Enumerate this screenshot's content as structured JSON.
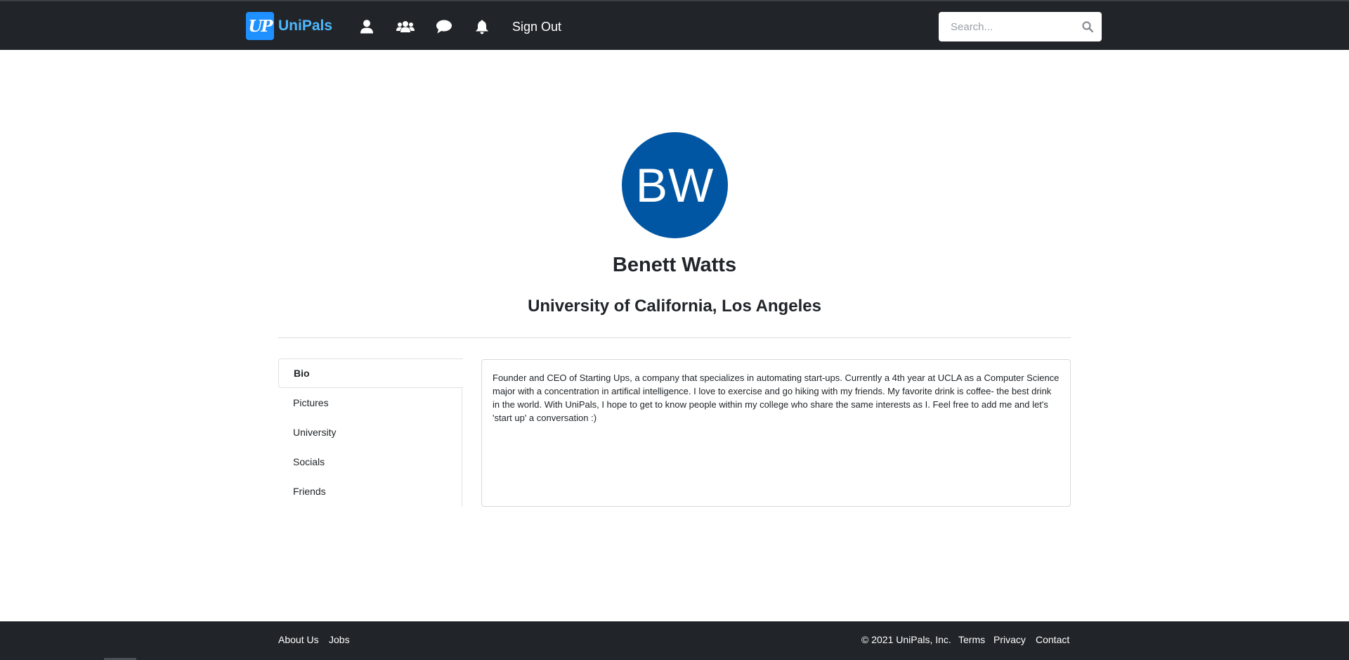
{
  "navbar": {
    "brand_logo": "UP",
    "brand_name": "UniPals",
    "icons": [
      "user-icon",
      "users-icon",
      "chat-icon",
      "bell-icon"
    ],
    "sign_out_label": "Sign Out",
    "search_placeholder": "Search..."
  },
  "profile": {
    "initials": "BW",
    "name": "Benett Watts",
    "university": "University of California, Los Angeles",
    "avatar_color": "#0056a3"
  },
  "tabs": [
    {
      "label": "Bio",
      "active": true
    },
    {
      "label": "Pictures",
      "active": false
    },
    {
      "label": "University",
      "active": false
    },
    {
      "label": "Socials",
      "active": false
    },
    {
      "label": "Friends",
      "active": false
    }
  ],
  "bio": {
    "text": "Founder and CEO of Starting Ups, a company that specializes in automating start-ups. Currently a 4th year at UCLA as a Computer Science major with a concentration in artifical intelligence. I love to exercise and go hiking with my friends. My favorite drink is coffee- the best drink in the world. With UniPals, I hope to get to know people within my college who share the same interests as I. Feel free to add me and let's 'start up' a conversation :)"
  },
  "footer": {
    "about_label": "About Us",
    "jobs_label": "Jobs",
    "copyright": "© 2021 UniPals, Inc.",
    "terms_label": "Terms",
    "privacy_label": "Privacy",
    "contact_label": "Contact"
  },
  "colors": {
    "navbar_bg": "#212529",
    "brand_accent": "#1e90ff",
    "brand_text": "#4fb8ff"
  }
}
